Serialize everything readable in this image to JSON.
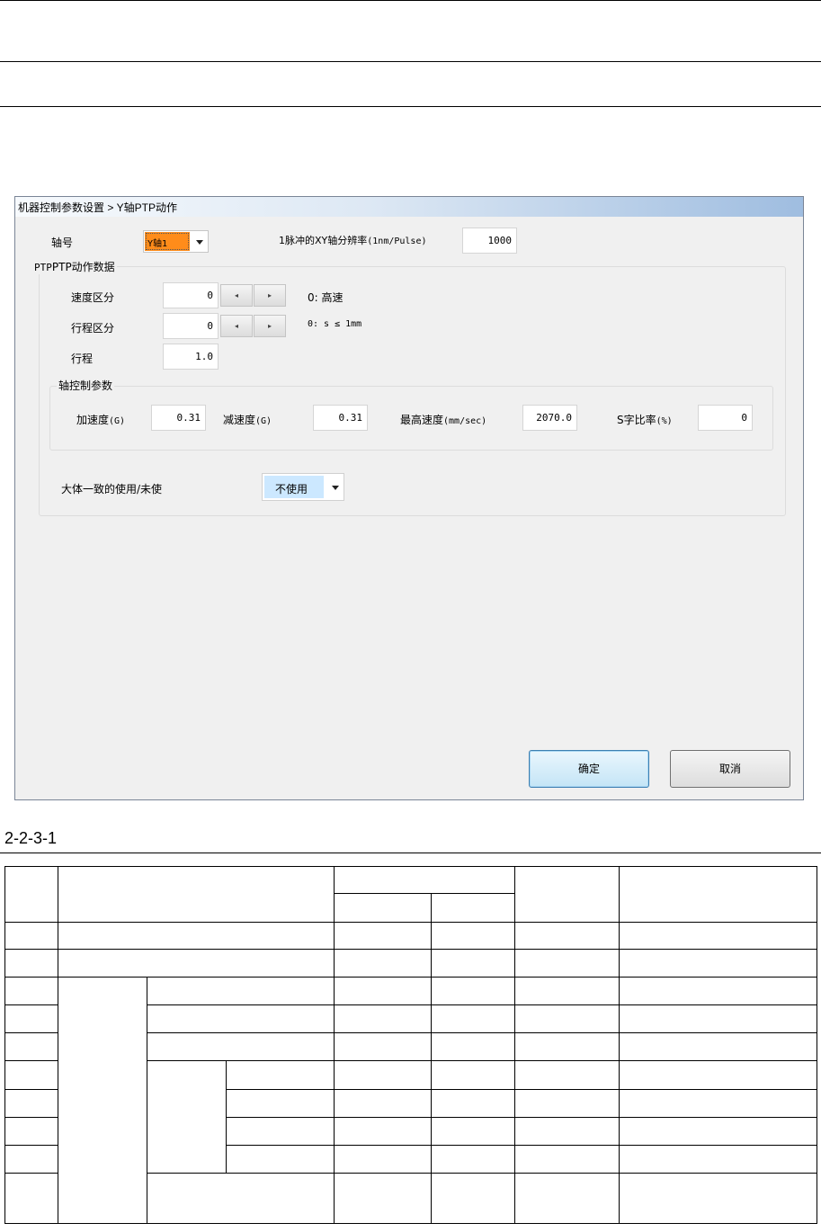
{
  "window": {
    "title": "机器控制参数设置 > Y轴PTP动作"
  },
  "axis_no": {
    "label": "轴号",
    "value": "Y轴1"
  },
  "resolution": {
    "label_pre": "1脉冲的XY轴分辨率",
    "label_unit": "(1nm/Pulse)",
    "value": "1000"
  },
  "ptp_group": {
    "title": "PTP动作数据",
    "speed": {
      "label": "速度区分",
      "value": "0",
      "hint": "0: 高速"
    },
    "travel_class": {
      "label": "行程区分",
      "value": "0",
      "hint": "0: s ≤ 1mm"
    },
    "travel": {
      "label": "行程",
      "value": "1.0"
    }
  },
  "axis_group": {
    "title": "轴控制参数",
    "accel": {
      "label": "加速度",
      "unit": "(G)",
      "value": "0.31"
    },
    "decel": {
      "label": "减速度",
      "unit": "(G)",
      "value": "0.31"
    },
    "max_speed": {
      "label": "最高速度",
      "unit": "(mm/sec)",
      "value": "2070.0"
    },
    "s_ratio": {
      "label": "S字比率",
      "unit": "(%)",
      "value": "0"
    }
  },
  "consistency": {
    "label": "大体一致的使用/未使",
    "value": "不使用"
  },
  "buttons": {
    "ok": "确定",
    "cancel": "取消"
  },
  "caption": "2-2-3-1",
  "colors": {
    "axis_select": "#ff8c1a",
    "dropdown_highlight": "#cce8ff",
    "title_bar_end": "#9fbde0"
  }
}
